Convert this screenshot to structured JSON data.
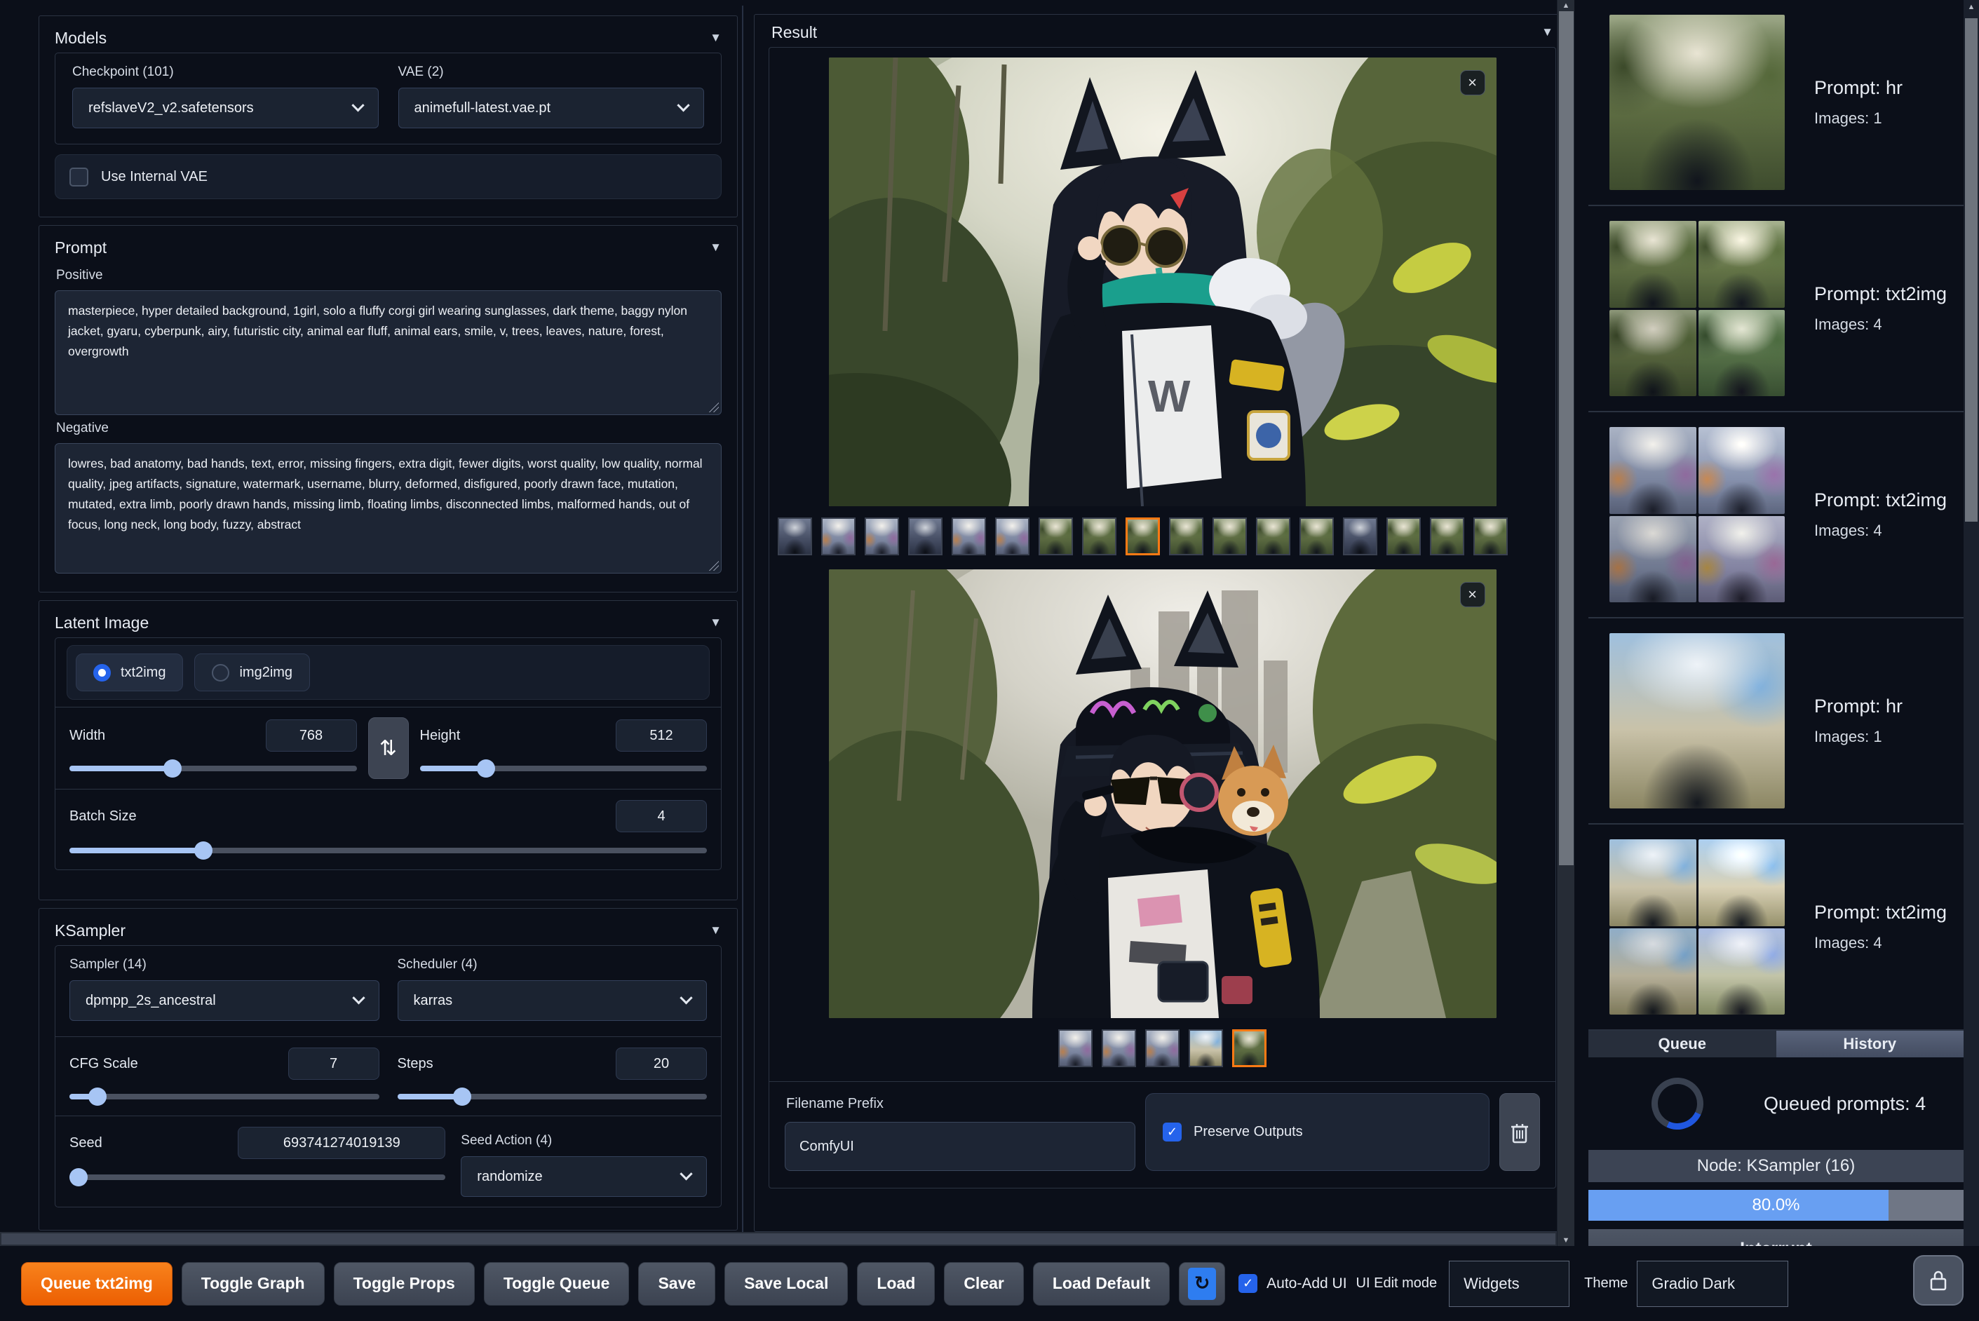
{
  "models": {
    "title": "Models",
    "checkpoint_label": "Checkpoint (101)",
    "checkpoint_value": "refslaveV2_v2.safetensors",
    "vae_label": "VAE (2)",
    "vae_value": "animefull-latest.vae.pt",
    "use_internal_vae_label": "Use Internal VAE",
    "use_internal_vae_checked": false
  },
  "prompt": {
    "title": "Prompt",
    "positive_label": "Positive",
    "positive_value": "masterpiece, hyper detailed background, 1girl, solo a fluffy corgi girl wearing sunglasses, dark theme, baggy nylon jacket, gyaru, cyberpunk, airy, futuristic city, animal ear fluff, animal ears, smile, v, trees, leaves, nature, forest, overgrowth",
    "negative_label": "Negative",
    "negative_value": "lowres, bad anatomy, bad hands, text, error, missing fingers, extra digit, fewer digits, worst quality, low quality, normal quality, jpeg artifacts, signature, watermark, username, blurry, deformed, disfigured, poorly drawn face, mutation, mutated, extra limb, poorly drawn hands, missing limb, floating limbs, disconnected limbs, malformed hands, out of focus, long neck, long body, fuzzy, abstract"
  },
  "latent": {
    "title": "Latent Image",
    "mode_options": [
      {
        "label": "txt2img",
        "selected": true
      },
      {
        "label": "img2img",
        "selected": false
      }
    ],
    "width_label": "Width",
    "width_value": "768",
    "height_label": "Height",
    "height_value": "512",
    "batch_label": "Batch Size",
    "batch_value": "4"
  },
  "ksampler": {
    "title": "KSampler",
    "sampler_label": "Sampler (14)",
    "sampler_value": "dpmpp_2s_ancestral",
    "scheduler_label": "Scheduler (4)",
    "scheduler_value": "karras",
    "cfg_label": "CFG Scale",
    "cfg_value": "7",
    "steps_label": "Steps",
    "steps_value": "20",
    "seed_label": "Seed",
    "seed_value": "693741274019139",
    "seed_action_label": "Seed Action (4)",
    "seed_action_value": "randomize"
  },
  "result": {
    "title": "Result",
    "gallery1": {
      "count": 17,
      "selected_index": 9
    },
    "gallery2": {
      "count": 5,
      "selected_index": 5
    },
    "filename_prefix_label": "Filename Prefix",
    "filename_prefix_value": "ComfyUI",
    "preserve_outputs_label": "Preserve Outputs",
    "preserve_outputs_checked": true
  },
  "history": {
    "tabs": [
      {
        "label": "Queue",
        "active": false
      },
      {
        "label": "History",
        "active": true
      }
    ],
    "items": [
      {
        "prompt": "Prompt: hr",
        "images": "Images: 1",
        "layout": "single",
        "variant": "green"
      },
      {
        "prompt": "Prompt: txt2img",
        "images": "Images: 4",
        "layout": "grid",
        "variant": "green"
      },
      {
        "prompt": "Prompt: txt2img",
        "images": "Images: 4",
        "layout": "grid",
        "variant": "city"
      },
      {
        "prompt": "Prompt: hr",
        "images": "Images: 1",
        "layout": "single",
        "variant": "sky"
      },
      {
        "prompt": "Prompt: txt2img",
        "images": "Images: 4",
        "layout": "grid",
        "variant": "sky"
      }
    ],
    "queued_text": "Queued prompts: 4",
    "node_text": "Node: KSampler (16)",
    "progress_text": "80.0%",
    "progress_pct": 80,
    "interrupt_label": "Interrupt"
  },
  "toolbar": {
    "buttons": [
      {
        "label": "Queue txt2img",
        "primary": true
      },
      {
        "label": "Toggle Graph"
      },
      {
        "label": "Toggle Props"
      },
      {
        "label": "Toggle Queue"
      },
      {
        "label": "Save"
      },
      {
        "label": "Save Local"
      },
      {
        "label": "Load"
      },
      {
        "label": "Clear"
      },
      {
        "label": "Load Default"
      }
    ],
    "auto_add_label": "Auto-Add UI",
    "auto_add_checked": true,
    "ui_edit_label": "UI Edit mode",
    "widgets_value": "Widgets",
    "theme_label": "Theme",
    "theme_value": "Gradio Dark"
  },
  "colors": {
    "accent_orange": "#ee6002",
    "accent_blue": "#2563eb",
    "progress_blue": "#689ff2",
    "selection_orange": "#ff7a14"
  }
}
